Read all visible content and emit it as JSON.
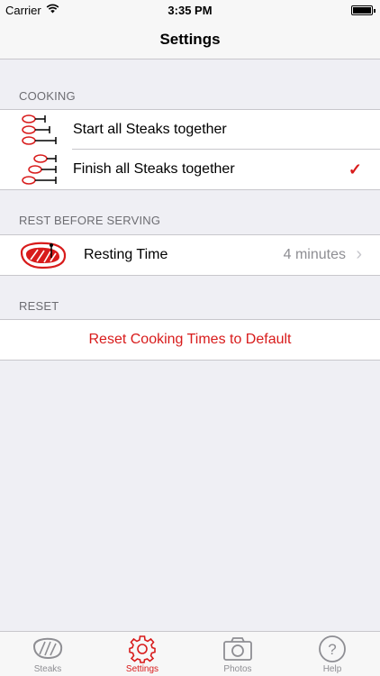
{
  "status_bar": {
    "carrier": "Carrier",
    "time": "3:35 PM"
  },
  "nav": {
    "title": "Settings"
  },
  "sections": {
    "cooking": {
      "header": "COOKING",
      "items": [
        {
          "label": "Start all Steaks together",
          "icon": "steaks-start-icon",
          "selected": false
        },
        {
          "label": "Finish all Steaks together",
          "icon": "steaks-finish-icon",
          "selected": true
        }
      ]
    },
    "rest": {
      "header": "REST BEFORE SERVING",
      "item": {
        "label": "Resting Time",
        "value": "4 minutes",
        "icon": "steak-thermometer-icon"
      }
    },
    "reset": {
      "header": "RESET",
      "action": "Reset Cooking Times to Default"
    }
  },
  "tabs": [
    {
      "label": "Steaks",
      "icon": "steak-icon",
      "active": false
    },
    {
      "label": "Settings",
      "icon": "gear-icon",
      "active": true
    },
    {
      "label": "Photos",
      "icon": "camera-icon",
      "active": false
    },
    {
      "label": "Help",
      "icon": "help-icon",
      "active": false
    }
  ],
  "colors": {
    "accent": "#d81b1b",
    "background": "#efeff4",
    "secondary_text": "#8e8e93"
  }
}
